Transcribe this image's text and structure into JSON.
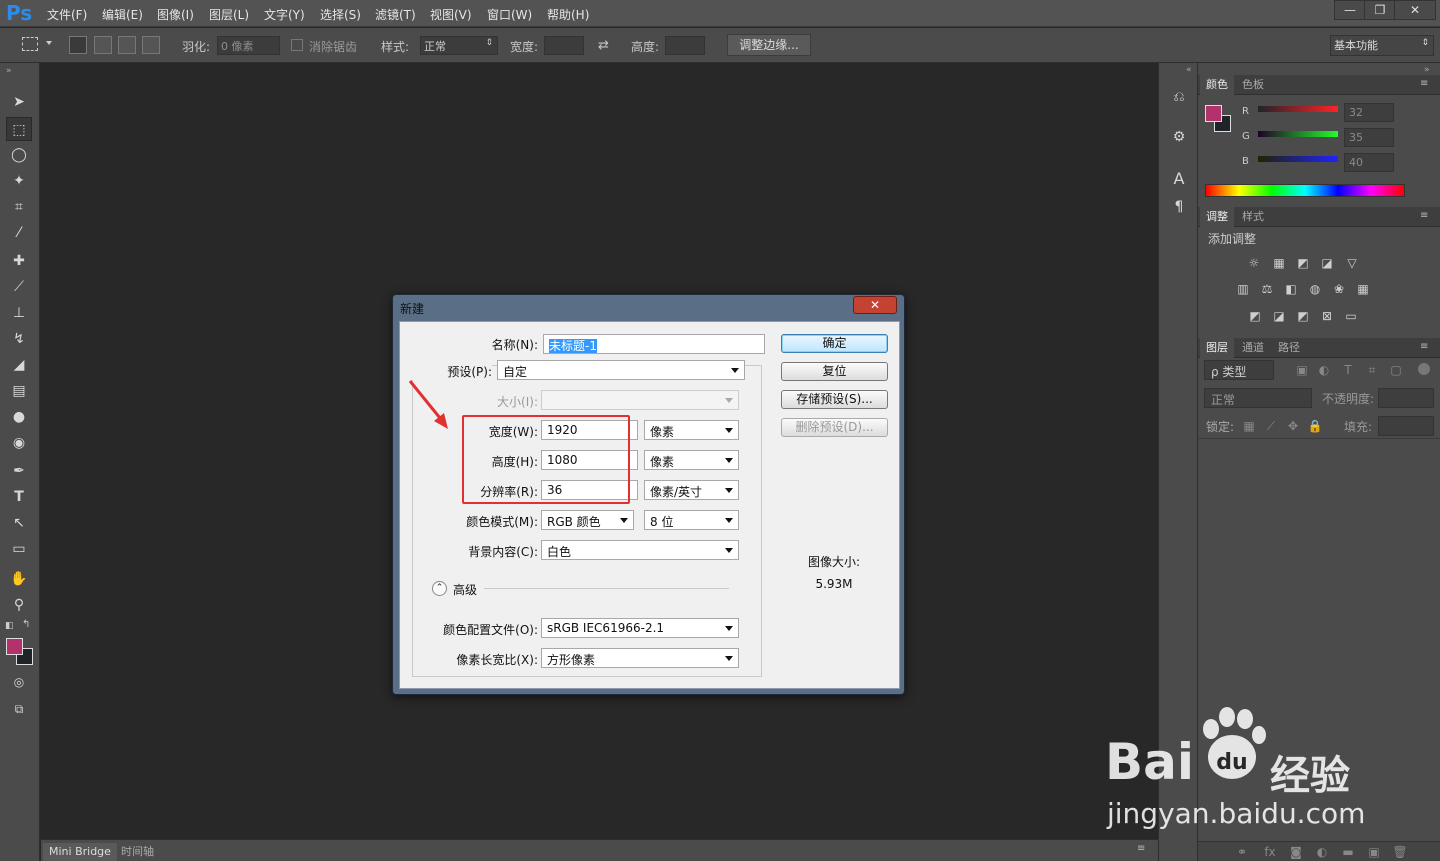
{
  "app": {
    "logo": "Ps"
  },
  "menubar": {
    "items": [
      "文件(F)",
      "编辑(E)",
      "图像(I)",
      "图层(L)",
      "文字(Y)",
      "选择(S)",
      "滤镜(T)",
      "视图(V)",
      "窗口(W)",
      "帮助(H)"
    ]
  },
  "options": {
    "feather_label": "羽化:",
    "feather_value": "0 像素",
    "antialias_label": "消除锯齿",
    "style_label": "样式:",
    "style_value": "正常",
    "width_label": "宽度:",
    "height_label": "高度:",
    "refine_button": "调整边缘...",
    "workspace": "基本功能"
  },
  "bottom_tabs": [
    "Mini Bridge",
    "时间轴"
  ],
  "color_panel": {
    "tabs": [
      "颜色",
      "色板"
    ],
    "channels": [
      {
        "name": "R",
        "value": "32"
      },
      {
        "name": "G",
        "value": "35"
      },
      {
        "name": "B",
        "value": "40"
      }
    ],
    "foreground": "#b2326c",
    "background": "#202328"
  },
  "adjust_panel": {
    "tabs": [
      "调整",
      "样式"
    ],
    "heading": "添加调整"
  },
  "layers_panel": {
    "tabs": [
      "图层",
      "通道",
      "路径"
    ],
    "filter_value": "ρ 类型",
    "blend_value": "正常",
    "opacity_label": "不透明度:",
    "lock_label": "锁定:",
    "fill_label": "填充:"
  },
  "dialog": {
    "title": "新建",
    "close": "✕",
    "name_label": "名称(N):",
    "name_value": "未标题-1",
    "preset_label": "预设(P):",
    "preset_value": "自定",
    "size_label": "大小(I):",
    "width_label": "宽度(W):",
    "width_value": "1920",
    "width_unit": "像素",
    "height_label": "高度(H):",
    "height_value": "1080",
    "height_unit": "像素",
    "resolution_label": "分辨率(R):",
    "resolution_value": "36",
    "resolution_unit": "像素/英寸",
    "colormode_label": "颜色模式(M):",
    "colormode_value": "RGB 颜色",
    "bitdepth_value": "8 位",
    "background_label": "背景内容(C):",
    "background_value": "白色",
    "advanced_label": "高级",
    "profile_label": "颜色配置文件(O):",
    "profile_value": "sRGB IEC61966-2.1",
    "aspect_label": "像素长宽比(X):",
    "aspect_value": "方形像素",
    "ok_button": "确定",
    "reset_button": "复位",
    "save_preset_button": "存储预设(S)...",
    "delete_preset_button": "删除预设(D)...",
    "image_size_label": "图像大小:",
    "image_size_value": "5.93M"
  },
  "watermark": {
    "brand": "Bai",
    "brand_cn": "经验",
    "url": "jingyan.baidu.com"
  },
  "colors": {
    "highlight_box": "#e03030",
    "arrow": "#e03030"
  }
}
